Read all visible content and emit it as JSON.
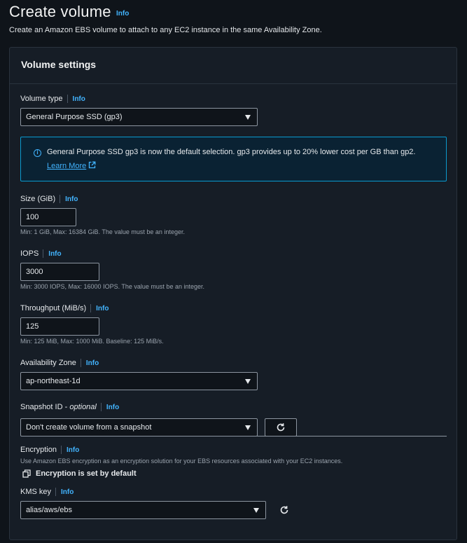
{
  "header": {
    "title": "Create volume",
    "info": "Info",
    "description": "Create an Amazon EBS volume to attach to any EC2 instance in the same Availability Zone."
  },
  "panel": {
    "title": "Volume settings"
  },
  "volume_type": {
    "label": "Volume type",
    "info": "Info",
    "value": "General Purpose SSD (gp3)"
  },
  "alert": {
    "text": "General Purpose SSD gp3 is now the default selection. gp3 provides up to 20% lower cost per GB than gp2.",
    "link": "Learn More"
  },
  "size": {
    "label": "Size (GiB)",
    "info": "Info",
    "value": "100",
    "hint": "Min: 1 GiB, Max: 16384 GiB. The value must be an integer."
  },
  "iops": {
    "label": "IOPS",
    "info": "Info",
    "value": "3000",
    "hint": "Min: 3000 IOPS, Max: 16000 IOPS. The value must be an integer."
  },
  "throughput": {
    "label": "Throughput (MiB/s)",
    "info": "Info",
    "value": "125",
    "hint": "Min: 125 MiB, Max: 1000 MiB. Baseline: 125 MiB/s."
  },
  "availability_zone": {
    "label": "Availability Zone",
    "info": "Info",
    "value": "ap-northeast-1d"
  },
  "snapshot": {
    "label": "Snapshot ID",
    "optional": "optional",
    "info": "Info",
    "value": "Don't create volume from a snapshot"
  },
  "encryption": {
    "label": "Encryption",
    "info": "Info",
    "description": "Use Amazon EBS encryption as an encryption solution for your EBS resources associated with your EC2 instances.",
    "default_text": "Encryption is set by default"
  },
  "kms": {
    "label": "KMS key",
    "info": "Info",
    "value": "alias/aws/ebs"
  },
  "colors": {
    "background": "#0f141a",
    "panel": "#161d26",
    "link": "#42b4ff",
    "alert_border": "#0a9acf"
  },
  "icons": [
    "info-circle-icon",
    "external-link-icon",
    "caret-down-icon",
    "refresh-icon",
    "copy-icon"
  ]
}
